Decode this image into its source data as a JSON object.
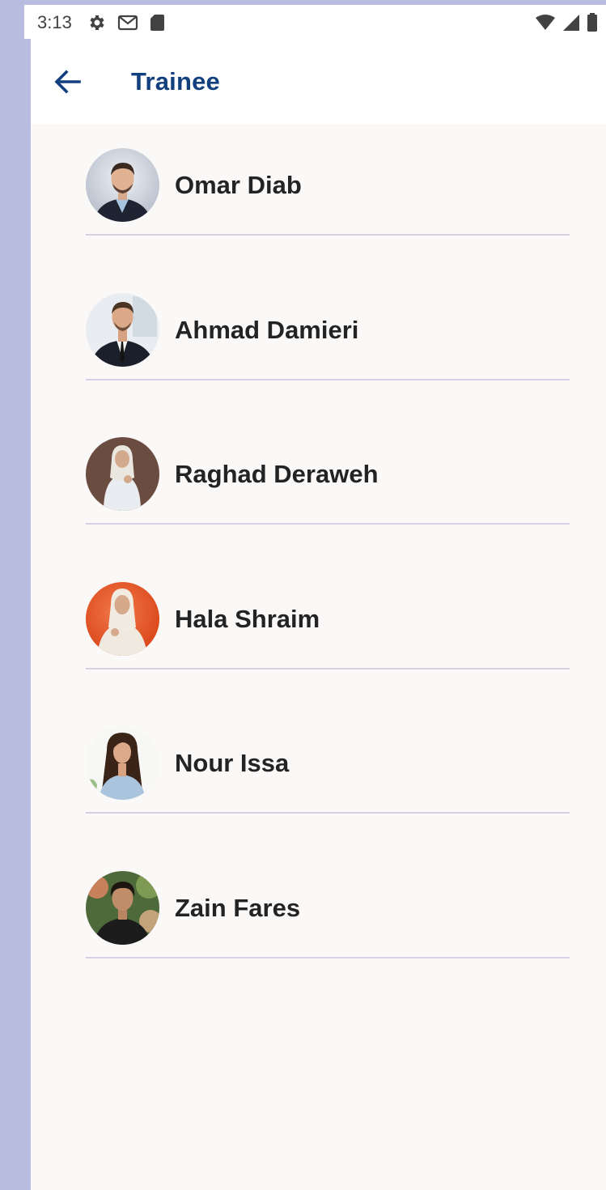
{
  "status_bar": {
    "time": "3:13",
    "icons": [
      "gear-icon",
      "gmail-icon",
      "sd-card-icon",
      "wifi-icon",
      "signal-icon",
      "battery-icon"
    ]
  },
  "app_bar": {
    "back_icon": "arrow-left-icon",
    "title": "Trainee"
  },
  "trainees": [
    {
      "name": "Omar Diab",
      "avatar": "photo-man-suit"
    },
    {
      "name": "Ahmad Damieri",
      "avatar": "photo-man-tie"
    },
    {
      "name": "Raghad Deraweh",
      "avatar": "photo-woman-hijab-brown-bg"
    },
    {
      "name": "Hala Shraim",
      "avatar": "photo-woman-hijab-orange-bg"
    },
    {
      "name": "Nour Issa",
      "avatar": "photo-woman-long-hair"
    },
    {
      "name": "Zain Fares",
      "avatar": "photo-man-curly-hair"
    }
  ],
  "colors": {
    "title": "#123f7d",
    "name_text": "#232323",
    "divider": "#d6d0e4",
    "background": "#fbf8f8",
    "frame": "#b8bde0"
  }
}
